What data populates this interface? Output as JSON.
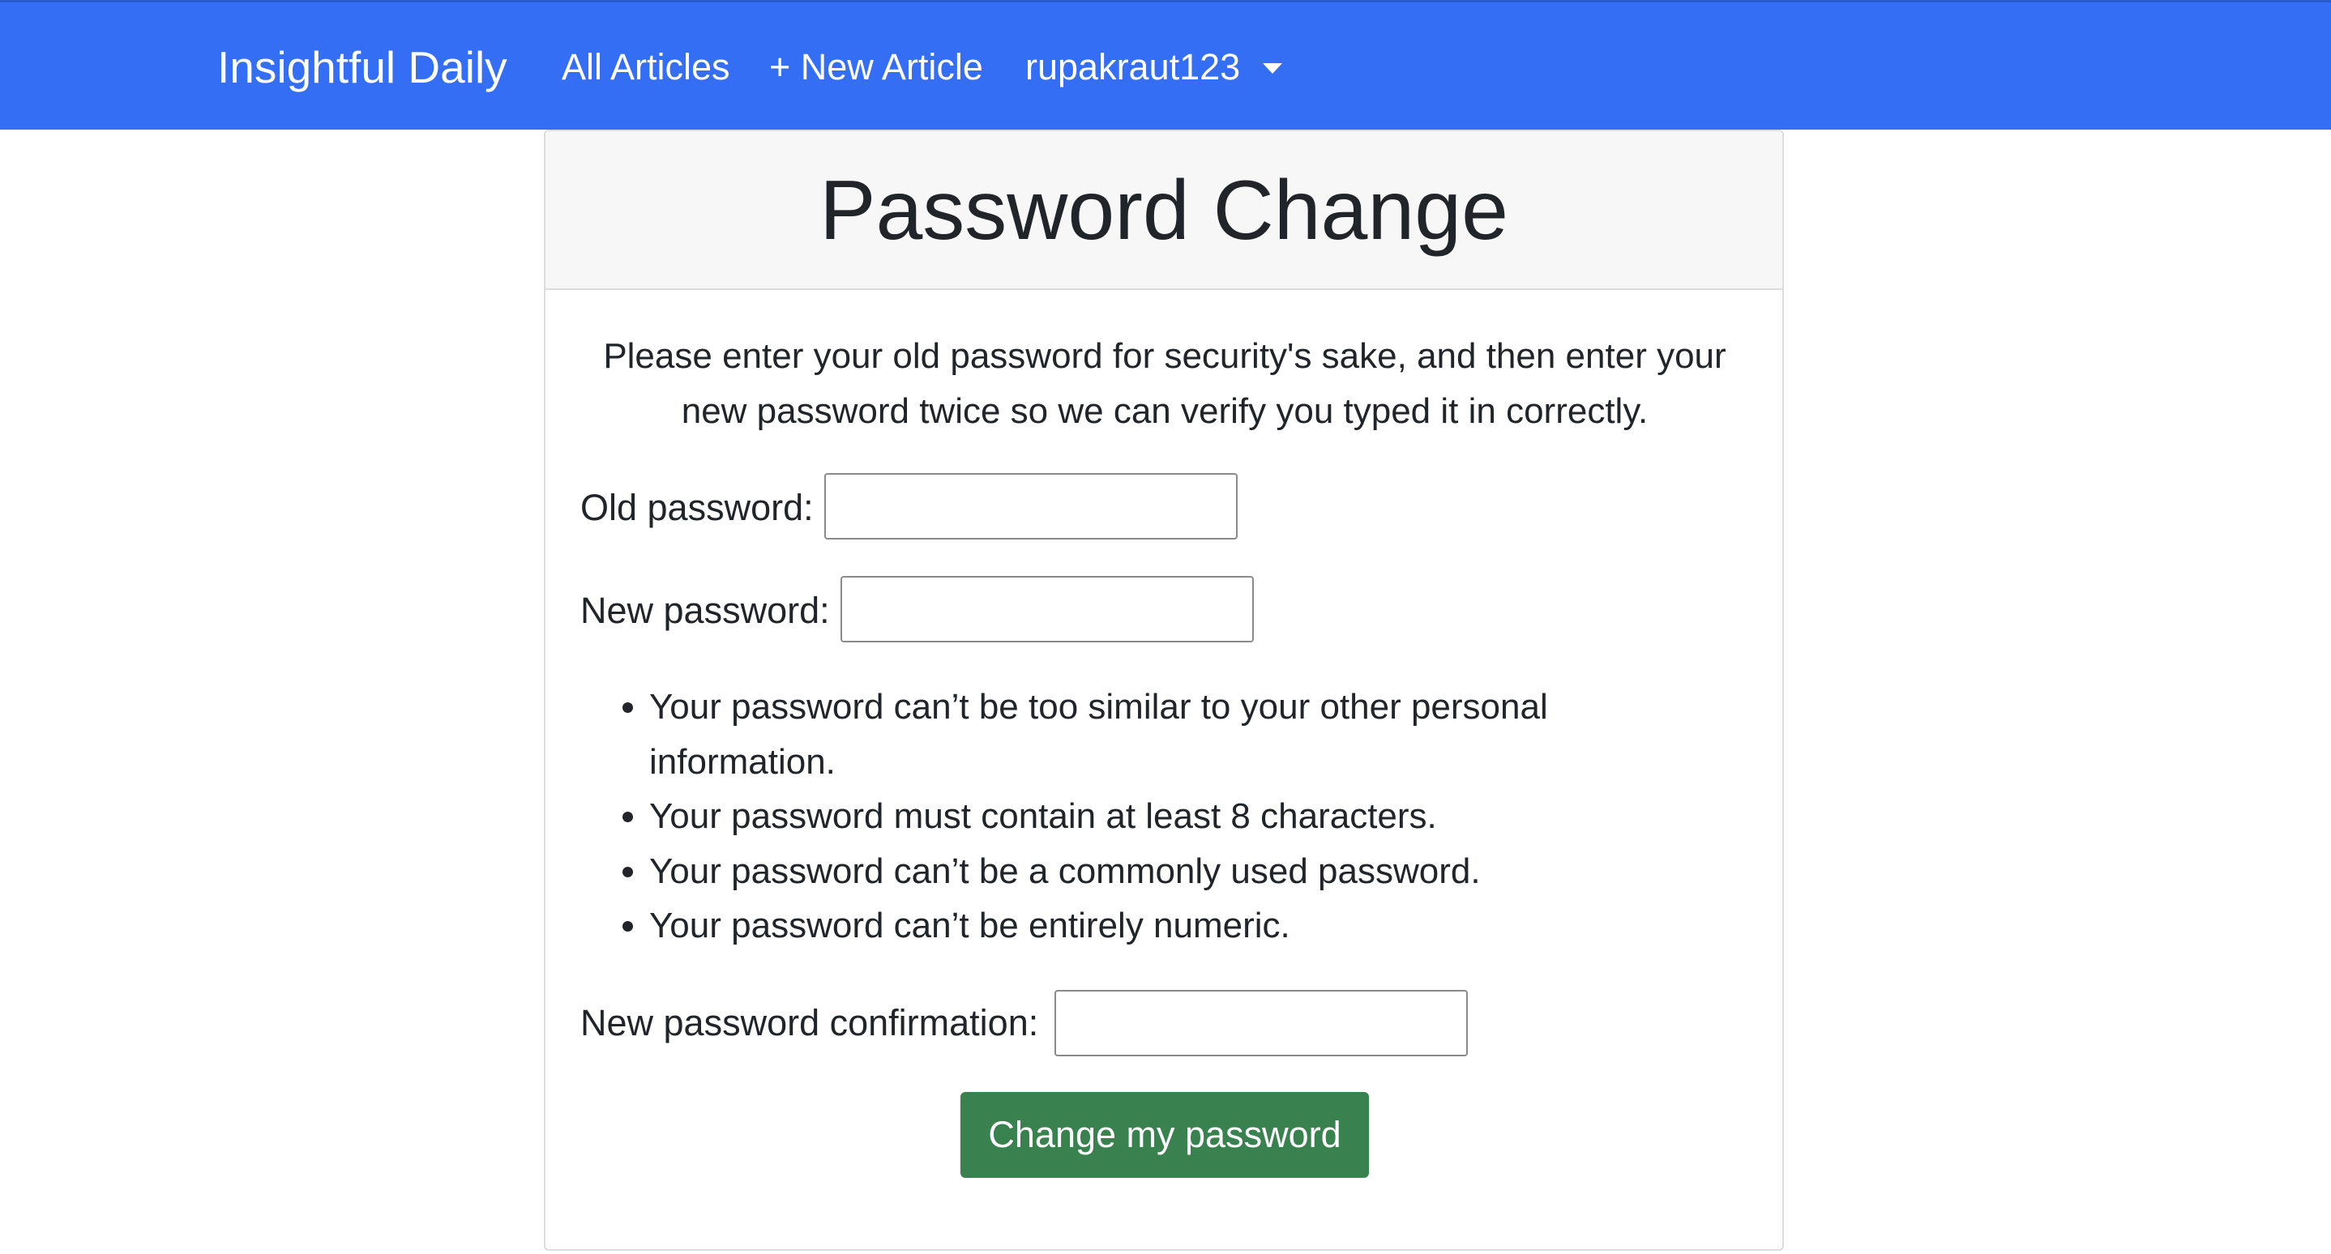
{
  "navbar": {
    "brand": "Insightful Daily",
    "links": [
      {
        "label": "All Articles"
      },
      {
        "label": "+ New Article"
      }
    ],
    "user_menu": {
      "label": "rupakraut123"
    }
  },
  "colors": {
    "navbar_bg": "#346ef5",
    "button_bg": "#3a8150",
    "card_header_bg": "#f7f7f7"
  },
  "form": {
    "title": "Password Change",
    "intro": "Please enter your old password for security's sake, and then enter your new password twice so we can verify you typed it in correctly.",
    "fields": {
      "old_password": {
        "label": "Old password:",
        "value": ""
      },
      "new_password": {
        "label": "New password:",
        "value": ""
      },
      "new_password_confirmation": {
        "label": "New password confirmation:",
        "value": ""
      }
    },
    "help_text": [
      "Your password can’t be too similar to your other personal information.",
      "Your password must contain at least 8 characters.",
      "Your password can’t be a commonly used password.",
      "Your password can’t be entirely numeric."
    ],
    "submit_label": "Change my password"
  }
}
